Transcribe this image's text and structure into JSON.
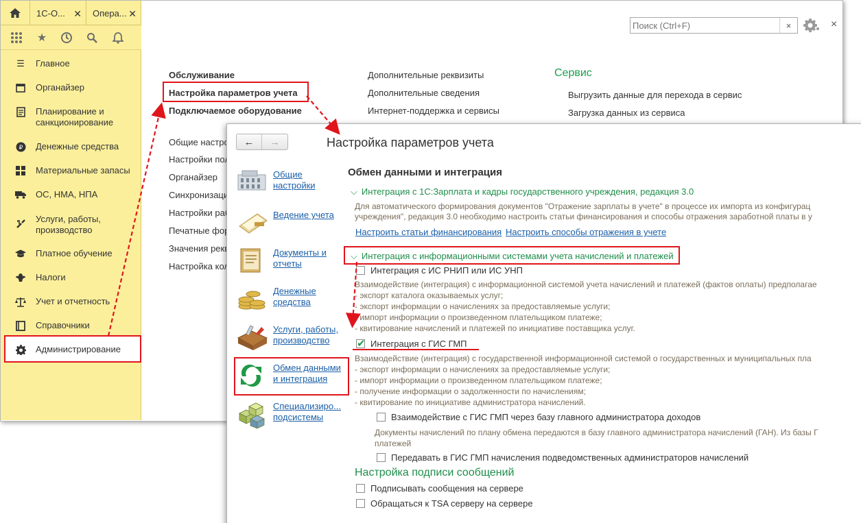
{
  "back_window": {
    "tabs": {
      "home_icon": "home-icon",
      "tab1_label": "1С-О...",
      "tab2_label": "Опера..."
    },
    "toolbar_icons": [
      "apps-grid-icon",
      "star-icon",
      "history-icon",
      "search-icon",
      "bell-icon"
    ],
    "sidebar": {
      "items": [
        {
          "label": "Главное",
          "icon": "menu-icon"
        },
        {
          "label": "Органайзер",
          "icon": "calendar-icon"
        },
        {
          "label": "Планирование и\nсанкционирование",
          "icon": "document-icon"
        },
        {
          "label": "Денежные средства",
          "icon": "coin-icon"
        },
        {
          "label": "Материальные запасы",
          "icon": "grid-icon"
        },
        {
          "label": "ОС, НМА, НПА",
          "icon": "truck-icon"
        },
        {
          "label": "Услуги, работы,\nпроизводство",
          "icon": "tools-icon"
        },
        {
          "label": "Платное обучение",
          "icon": "graduation-icon"
        },
        {
          "label": "Налоги",
          "icon": "eagle-icon"
        },
        {
          "label": "Учет и отчетность",
          "icon": "balance-icon"
        },
        {
          "label": "Справочники",
          "icon": "book-icon"
        },
        {
          "label": "Администрирование",
          "icon": "gear-icon"
        }
      ]
    },
    "search": {
      "placeholder": "Поиск (Ctrl+F)",
      "clear": "×"
    },
    "close_label": "×",
    "main": {
      "col1_bold": [
        "Обслуживание",
        "Настройка параметров учета",
        "Подключаемое оборудование"
      ],
      "col1_items": [
        "Общие настро",
        "Настройки пол",
        "Органайзер",
        "Синхронизаци",
        "Настройки раб",
        "Печатные фор",
        "Значения рекв",
        "Настройка кол"
      ],
      "col2_items": [
        "Дополнительные реквизиты",
        "Дополнительные сведения",
        "Интернет-поддержка и сервисы"
      ],
      "service_heading": "Сервис",
      "col3_items": [
        "Выгрузить данные для перехода в сервис",
        "Загрузка данных из сервиса"
      ]
    }
  },
  "front_window": {
    "back_arrow": "←",
    "forward_arrow": "→",
    "title": "Настройка параметров учета",
    "nav": [
      {
        "label": "Общие\nнастройки"
      },
      {
        "label": "Ведение учета"
      },
      {
        "label": "Документы и\nотчеты"
      },
      {
        "label": "Денежные\nсредства"
      },
      {
        "label": "Услуги, работы,\nпроизводство"
      },
      {
        "label": "Обмен данными\nи интеграция"
      },
      {
        "label": "Специализиро...\nподсистемы"
      }
    ],
    "section_heading": "Обмен данными и интеграция",
    "zarplata": {
      "heading": "Интеграция с 1С:Зарплата и кадры государственного учреждения, редакция 3.0",
      "desc1": "Для автоматического формирования документов \"Отражение зарплаты в учете\" в процессе их импорта из конфигурац",
      "desc2": "учреждения\", редакция 3.0 необходимо настроить  статьи финансирования и способы отражения заработной платы в у",
      "link1": "Настроить статьи финансирования",
      "link2": "Настроить способы отражения в учете"
    },
    "integration": {
      "heading": "Интеграция с информационными системами учета начислений и платежей",
      "rnip_label": "Интеграция с ИС РНИП или ИС УНП",
      "rnip_desc": [
        "Взаимодействие (интеграция) с информационной системой учета начислений и платежей (фактов оплаты) предполагае",
        "- экспорт каталога оказываемых услуг;",
        "- экспорт информации о начислениях за предоставляемые услуги;",
        "- импорт информации о произведенном плательщиком платеже;",
        "- квитирование начислений и платежей по инициативе поставщика услуг."
      ],
      "gis_label": "Интеграция с ГИС ГМП",
      "gis_desc": [
        "Взаимодействие (интеграция) с государственной информационной системой о государственных и муниципальных пла",
        "- экспорт информации о начислениях за предоставляемые услуги;",
        "- импорт информации о произведенном плательщиком платеже;",
        "- получение информации о задолженности по начислениям;",
        "- квитирование по инициативе администратора начислений."
      ],
      "via_main_label": "Взаимодействие с ГИС ГМП через базу главного администратора доходов",
      "via_main_desc": [
        "Документы начислений по плану обмена передаются в базу главного администратора начислений (ГАН). Из базы Г",
        "платежей"
      ],
      "transfer_label": "Передавать в ГИС ГМП начисления подведомственных администраторов начислений"
    },
    "signature": {
      "heading": "Настройка подписи сообщений",
      "sign_label": "Подписывать сообщения на сервере",
      "tsa_label": "Обращаться к TSA серверу на сервере"
    }
  },
  "colors": {
    "accent_yellow": "#fbef9c",
    "highlight_red": "#e0151b",
    "green": "#1f8e4a",
    "link_blue": "#1a5fa8"
  }
}
